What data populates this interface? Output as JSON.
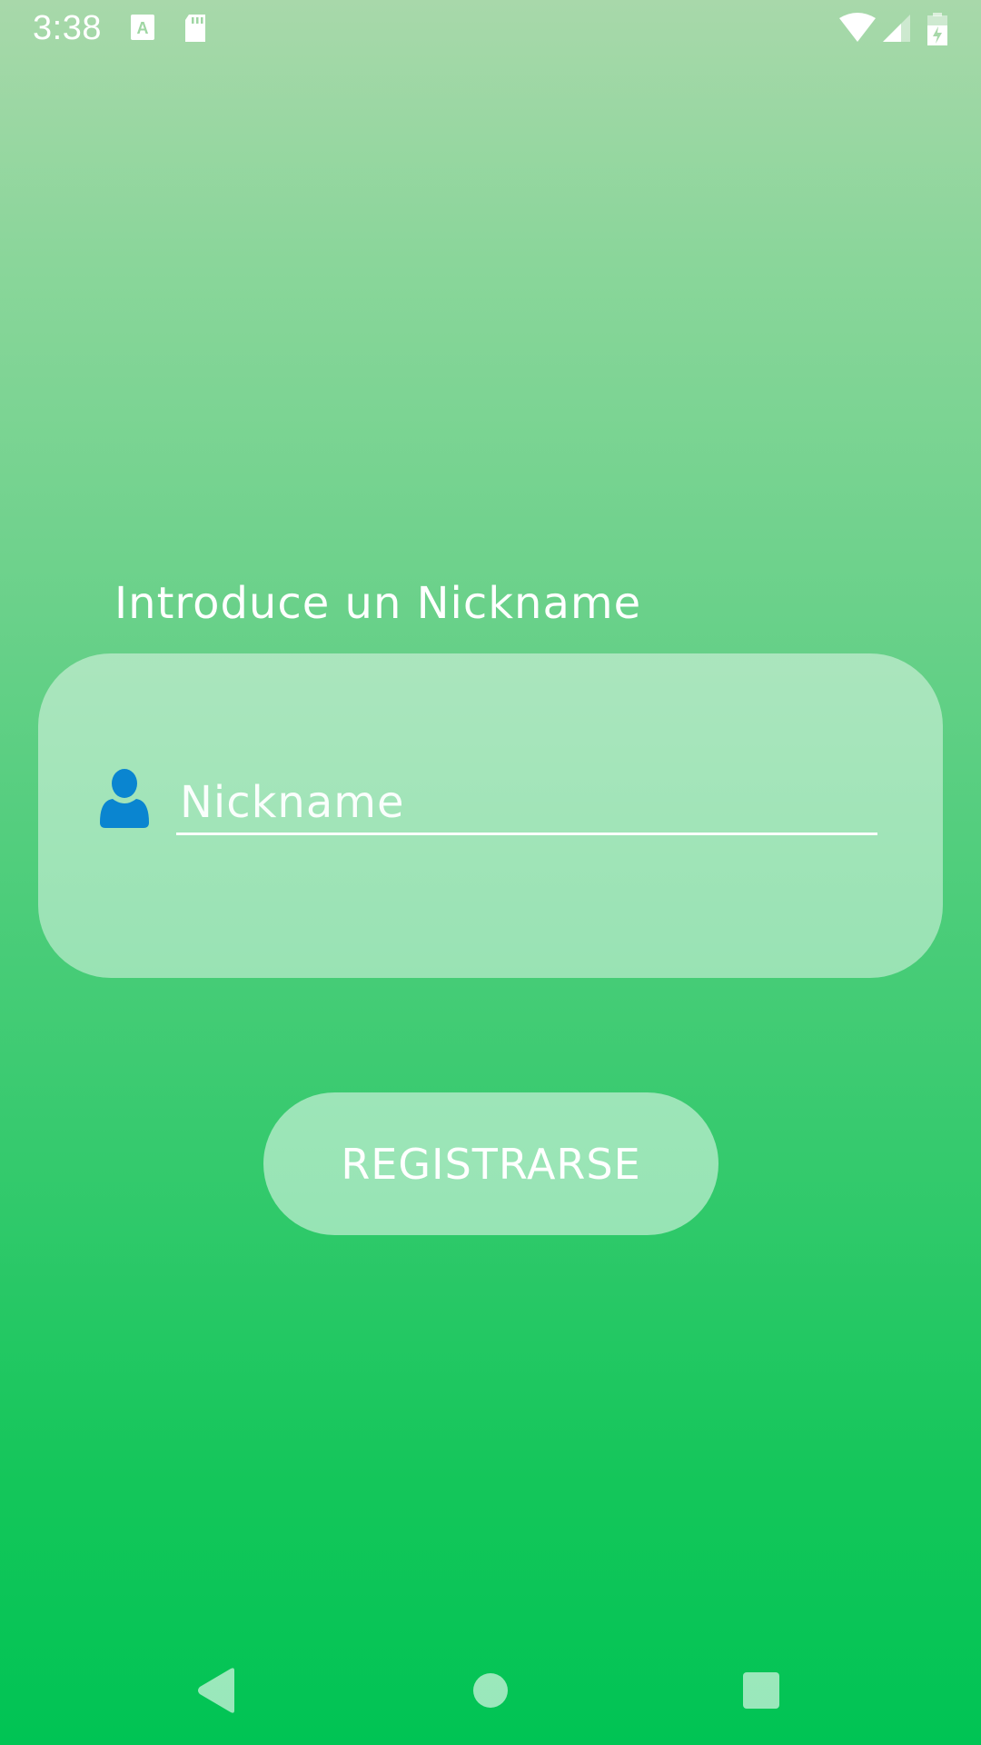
{
  "status_bar": {
    "time": "3:38",
    "icons": [
      "a-icon",
      "sd-card-icon",
      "wifi-icon",
      "cell-signal-icon",
      "battery-charging-icon"
    ]
  },
  "form": {
    "prompt_label": "Introduce un Nickname",
    "nickname_placeholder": "Nickname",
    "nickname_value": "",
    "field_icon": "user-icon"
  },
  "actions": {
    "register_label": "REGISTRARSE"
  },
  "navigation": {
    "icons": [
      "back-icon",
      "home-icon",
      "recent-apps-icon"
    ]
  },
  "colors": {
    "gradient_top": "#a8d8aa",
    "gradient_bottom": "#00c454",
    "user_icon": "#0a85d0",
    "text": "#ffffff"
  }
}
